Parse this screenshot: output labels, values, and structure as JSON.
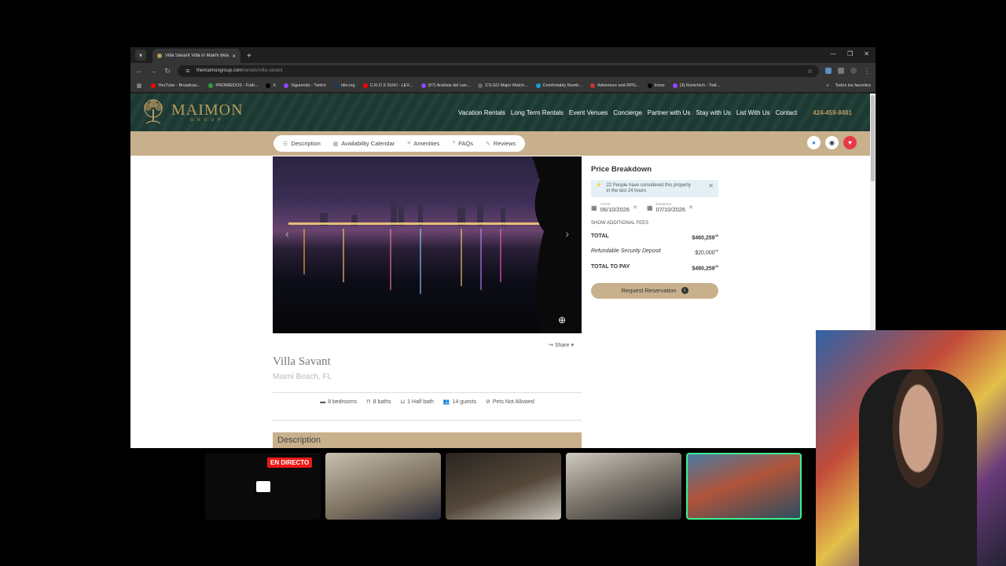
{
  "browser": {
    "tab_title": "Villa Savant Villa in Miami Bea...",
    "url_host": "themaimongroup.com",
    "url_path": "/rentals/villa-savant",
    "bookmarks": [
      {
        "label": "YouTube - Broadcas...",
        "color": "#ff0000"
      },
      {
        "label": "PROMIEDOS - Futb...",
        "color": "#2e9d3b"
      },
      {
        "label": "X",
        "color": "#000000"
      },
      {
        "label": "Siguiendo - Twitch",
        "color": "#9146ff"
      },
      {
        "label": "hltv.org",
        "color": "#1c3a5a"
      },
      {
        "label": "C.R.O X DUKI - LEX...",
        "color": "#ff0000"
      },
      {
        "label": "(57) Análisis del can...",
        "color": "#9146ff"
      },
      {
        "label": "CS:GO Major Match...",
        "color": "#666666"
      },
      {
        "label": "Comfortably Numb...",
        "color": "#1a9bd7"
      },
      {
        "label": "Adventure and RPG...",
        "color": "#cc3333"
      },
      {
        "label": "Inicio",
        "color": "#000000"
      },
      {
        "label": "(3) Ronichich - Twit...",
        "color": "#9146ff"
      }
    ],
    "bookmarks_more": "»",
    "all_bookmarks": "Todos los favoritos"
  },
  "site": {
    "logo_name": "MAIMON",
    "logo_sub": "GROUP",
    "nav": [
      "Vacation Rentals",
      "Long Term Rentals",
      "Event Venues",
      "Concierge",
      "Partner with Us",
      "Stay with Us",
      "List With Us",
      "Contact"
    ],
    "phone": "424-459-8481",
    "subnav": [
      {
        "label": "Description",
        "icon": "description-icon"
      },
      {
        "label": "Availability Calendar",
        "icon": "calendar-icon"
      },
      {
        "label": "Amenities",
        "icon": "list-icon"
      },
      {
        "label": "FAQs",
        "icon": "question-icon"
      },
      {
        "label": "Reviews",
        "icon": "edit-icon"
      }
    ]
  },
  "listing": {
    "title": "Villa Savant",
    "location": "Miami Beach, FL",
    "share": "Share",
    "specs": [
      "8 bedrooms",
      "8 baths",
      "1 Half bath",
      "14 guests",
      "Pets Not Allowed"
    ],
    "description_heading": "Description"
  },
  "price": {
    "heading": "Price Breakdown",
    "notice": "22 People have considered this property in the last 24 hours",
    "arrival_label": "Arrival",
    "arrival": "06/10/2026",
    "departure_label": "Departure",
    "departure": "07/10/2026",
    "show_fees": "SHOW ADDITIONAL FEES",
    "total_label": "TOTAL",
    "total": "$460,259",
    "total_cents": "25",
    "deposit_label": "Refundable Security Deposit",
    "deposit": "$20,000",
    "deposit_cents": "00",
    "pay_label": "TOTAL TO PAY",
    "pay": "$480,259",
    "pay_cents": "25",
    "request_button": "Request Reservation"
  },
  "stream": {
    "live_badge": "EN DIRECTO"
  },
  "colors": {
    "gold": "#c8b08c",
    "header_green": "#1c3a33",
    "live_red": "#e91916",
    "active_border": "#3df08f"
  }
}
